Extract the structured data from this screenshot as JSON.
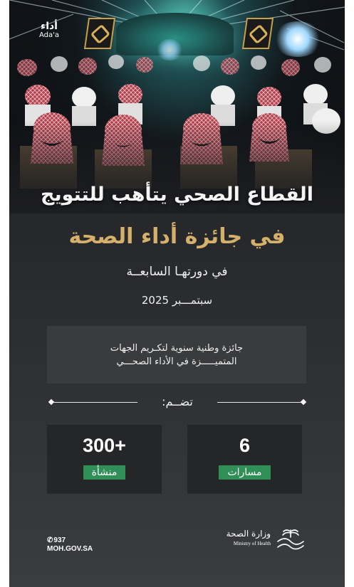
{
  "photo": {
    "ada_logo": {
      "arabic": "أداء",
      "english": "Ada'a"
    }
  },
  "headline": {
    "line1": "القطاع الصحي يتأهب للتتويج",
    "line2": "في جائزة أداء الصحة",
    "line3": "في دورتهـا السابعــة",
    "line4": "سبتمـــبر 2025"
  },
  "info_box": {
    "line1": "جائزة وطنية سنوية لتكـريم الجهات",
    "line2": "المتميـــــزة في الأداء الصحـــي"
  },
  "divider": {
    "label": "تضــم:"
  },
  "stats": [
    {
      "value": "300+",
      "label": "منشأة"
    },
    {
      "value": "6",
      "label": "مسارات"
    }
  ],
  "footer": {
    "phone": "937",
    "website": "MOH.GOV.SA",
    "ministry_arabic": "وزارة الصحة",
    "ministry_english": "Ministry of Health"
  },
  "colors": {
    "gold": "#d4b06a",
    "badge_green": "#2f8f57",
    "box_dark": "#252628",
    "box_mid": "#3a3b3d"
  }
}
